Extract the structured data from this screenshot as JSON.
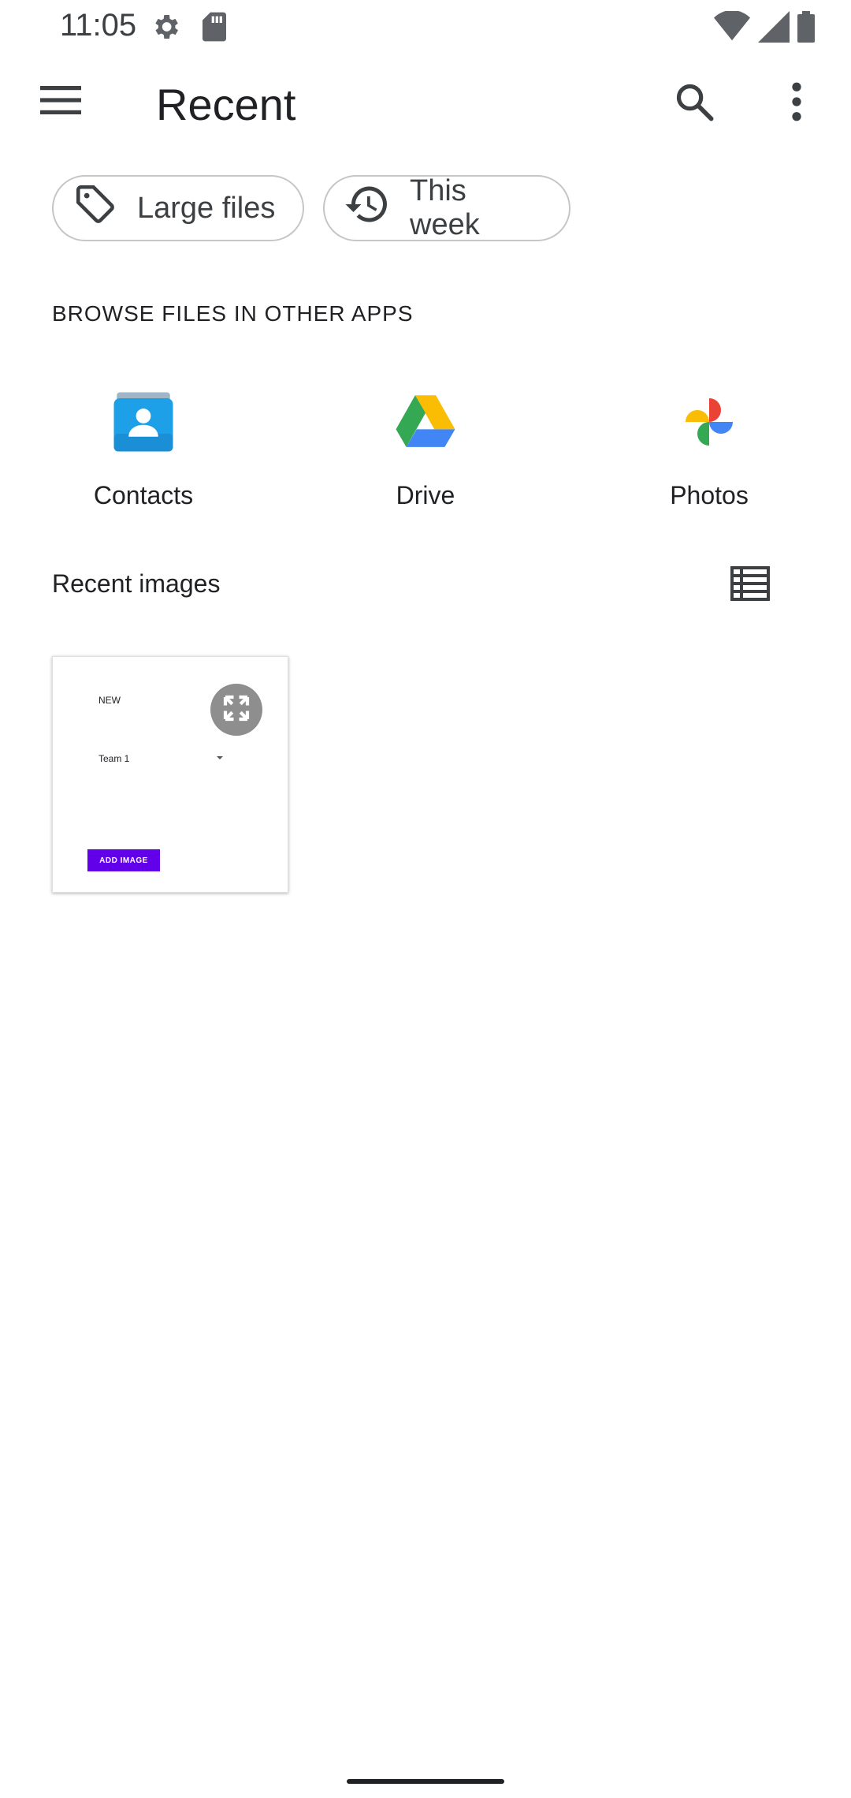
{
  "status_bar": {
    "time": "11:05",
    "left_icons": [
      "settings-icon",
      "sd-card-icon"
    ],
    "right_icons": [
      "wifi-icon",
      "signal-icon",
      "battery-icon"
    ]
  },
  "app_bar": {
    "title": "Recent",
    "menu_icon": "hamburger-menu-icon",
    "search_icon": "search-icon",
    "more_icon": "more-vert-icon"
  },
  "chips": [
    {
      "label": "Large files",
      "icon": "tag-icon"
    },
    {
      "label": "This week",
      "icon": "history-icon"
    }
  ],
  "browse_section": {
    "title": "BROWSE FILES IN OTHER APPS",
    "apps": [
      {
        "label": "Contacts",
        "icon": "contacts-app-icon"
      },
      {
        "label": "Drive",
        "icon": "drive-app-icon"
      },
      {
        "label": "Photos",
        "icon": "photos-app-icon"
      }
    ]
  },
  "recent_images": {
    "title": "Recent images",
    "view_toggle_icon": "list-view-icon",
    "thumbnail": {
      "text_new": "NEW",
      "text_team": "Team 1",
      "button_text": "ADD IMAGE",
      "button_color": "#6200ea",
      "expand_icon": "expand-icon"
    }
  },
  "colors": {
    "text_primary": "#202124",
    "chip_border": "#c4c7c5"
  }
}
